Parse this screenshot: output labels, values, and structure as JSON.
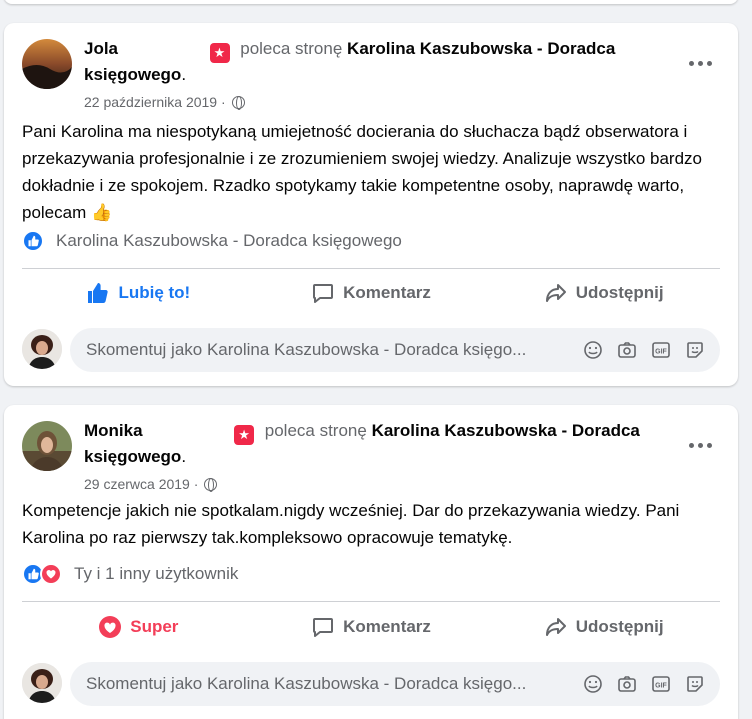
{
  "colors": {
    "accent": "#1877f2",
    "love": "#f33e58",
    "badge": "#f02849",
    "muted": "#65676b"
  },
  "posts": [
    {
      "author": "Jola",
      "recommends": "poleca stronę",
      "page_name": "Karolina Kaszubowska - Doradca księgowego",
      "date": "22 października 2019 ·",
      "text": "Pani Karolina ma niespotykaną umiejetność docierania do słuchacza bądź obserwatora i przekazywania profesjonalnie i ze zrozumieniem swojej wiedzy. Analizuje wszystko bardzo dokładnie i ze spokojem. Rzadko spotykamy takie kompetentne osoby, naprawdę warto, polecam 👍",
      "reactions_label": "Karolina Kaszubowska - Doradca księgowego",
      "reaction_icons": [
        "like-icon"
      ],
      "actions": {
        "react": "Lubię to!",
        "comment": "Komentarz",
        "share": "Udostępnij"
      },
      "comment_placeholder": "Skomentuj jako Karolina Kaszubowska - Doradca księgo..."
    },
    {
      "author": "Monika",
      "recommends": "poleca stronę",
      "page_name": "Karolina Kaszubowska - Doradca księgowego",
      "date": "29 czerwca 2019 ·",
      "text": "Kompetencje jakich nie spotkalam.nigdy wcześniej. Dar do przekazywania wiedzy. Pani Karolina po raz pierwszy tak.kompleksowo opracowuje tematykę.",
      "reactions_label": "Ty i 1 inny użytkownik",
      "reaction_icons": [
        "like-icon",
        "love-icon"
      ],
      "actions": {
        "react": "Super",
        "comment": "Komentarz",
        "share": "Udostępnij"
      },
      "comment_placeholder": "Skomentuj jako Karolina Kaszubowska - Doradca księgo..."
    }
  ]
}
